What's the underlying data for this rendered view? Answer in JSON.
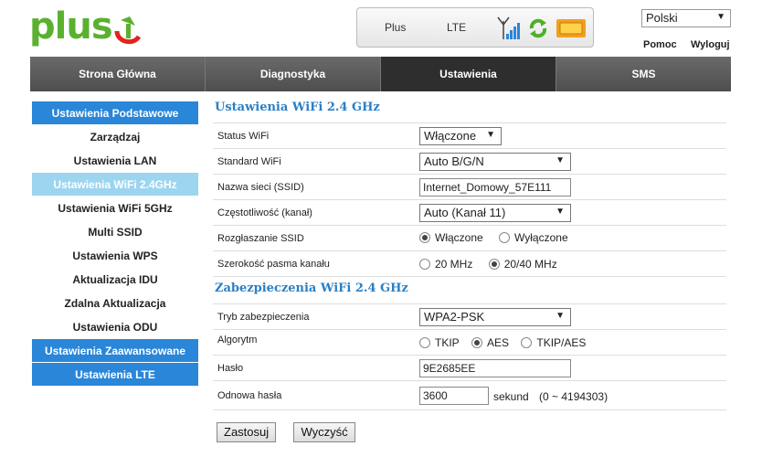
{
  "header": {
    "logo_text": "plus",
    "status": {
      "operator": "Plus",
      "network": "LTE"
    },
    "language": "Polski",
    "help_link": "Pomoc",
    "logout_link": "Wyloguj"
  },
  "nav": {
    "tabs": [
      {
        "label": "Strona Główna",
        "active": false
      },
      {
        "label": "Diagnostyka",
        "active": false
      },
      {
        "label": "Ustawienia",
        "active": true
      },
      {
        "label": "SMS",
        "active": false
      }
    ]
  },
  "sidebar": {
    "items": [
      {
        "label": "Ustawienia Podstawowe",
        "type": "head"
      },
      {
        "label": "Zarządzaj",
        "type": "item"
      },
      {
        "label": "Ustawienia LAN",
        "type": "item"
      },
      {
        "label": "Ustawienia WiFi 2.4GHz",
        "type": "active"
      },
      {
        "label": "Ustawienia WiFi 5GHz",
        "type": "item"
      },
      {
        "label": "Multi SSID",
        "type": "item"
      },
      {
        "label": "Ustawienia WPS",
        "type": "item"
      },
      {
        "label": "Aktualizacja IDU",
        "type": "item"
      },
      {
        "label": "Zdalna Aktualizacja",
        "type": "item"
      },
      {
        "label": "Ustawienia ODU",
        "type": "item"
      },
      {
        "label": "Ustawienia Zaawansowane",
        "type": "head"
      },
      {
        "label": "Ustawienia LTE",
        "type": "head"
      }
    ]
  },
  "wifi": {
    "title": "Ustawienia WiFi 2.4 GHz",
    "status_label": "Status WiFi",
    "status_value": "Włączone",
    "standard_label": "Standard WiFi",
    "standard_value": "Auto B/G/N",
    "ssid_label": "Nazwa sieci (SSID)",
    "ssid_value": "Internet_Domowy_57E111",
    "channel_label": "Częstotliwość (kanał)",
    "channel_value": "Auto (Kanał 11)",
    "broadcast_label": "Rozgłaszanie SSID",
    "broadcast_on": "Włączone",
    "broadcast_off": "Wyłączone",
    "bandwidth_label": "Szerokość pasma kanału",
    "bandwidth_20": "20 MHz",
    "bandwidth_2040": "20/40 MHz"
  },
  "security": {
    "title": "Zabezpieczenia WiFi 2.4 GHz",
    "mode_label": "Tryb zabezpieczenia",
    "mode_value": "WPA2-PSK",
    "algo_label": "Algorytm",
    "algo_tkip": "TKIP",
    "algo_aes": "AES",
    "algo_tkipaes": "TKIP/AES",
    "password_label": "Hasło",
    "password_value": "9E2685EE",
    "renew_label": "Odnowa hasła",
    "renew_value": "3600",
    "renew_unit": "sekund",
    "renew_range": "(0 ~ 4194303)"
  },
  "buttons": {
    "apply": "Zastosuj",
    "clear": "Wyczyść"
  },
  "colors": {
    "brand_green": "#5bb12f",
    "brand_red": "#e2241c",
    "accent_blue": "#2a86d8",
    "active_light_blue": "#9cd5ef"
  }
}
